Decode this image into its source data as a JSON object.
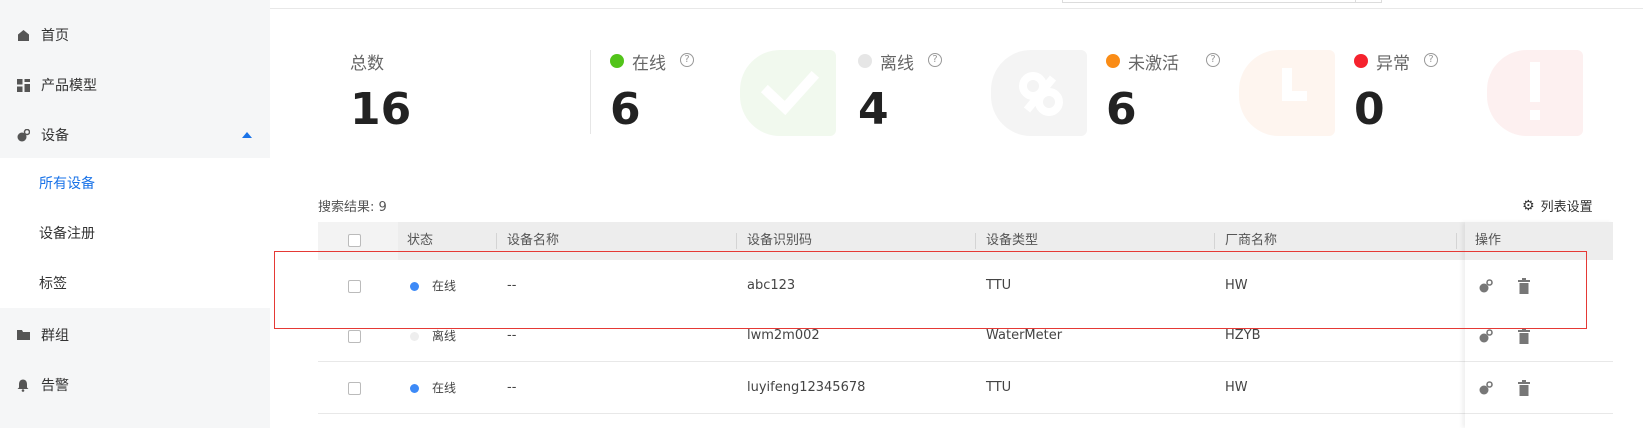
{
  "sidebar": {
    "items": [
      {
        "label": "首页",
        "icon": "home-icon"
      },
      {
        "label": "产品模型",
        "icon": "grid-icon"
      },
      {
        "label": "设备",
        "icon": "device-icon"
      },
      {
        "label": "群组",
        "icon": "folder-icon"
      },
      {
        "label": "告警",
        "icon": "bell-icon"
      }
    ],
    "sub_items": [
      {
        "label": "所有设备",
        "active": true
      },
      {
        "label": "设备注册",
        "active": false
      },
      {
        "label": "标签",
        "active": false
      }
    ]
  },
  "stats": {
    "total_label": "总数",
    "total_value": "16",
    "items": [
      {
        "label": "在线",
        "value": "6",
        "color": "#52c41a",
        "help": "?"
      },
      {
        "label": "离线",
        "value": "4",
        "color": "#e6e6e6",
        "help": "?"
      },
      {
        "label": "未激活",
        "value": "6",
        "color": "#fa8c16",
        "help": "?"
      },
      {
        "label": "异常",
        "value": "0",
        "color": "#f5222d",
        "help": "?"
      }
    ]
  },
  "table": {
    "result_label": "搜索结果: 9",
    "settings_label": "列表设置",
    "headers": [
      "状态",
      "设备名称",
      "设备识别码",
      "设备类型",
      "厂商名称",
      "操作"
    ],
    "rows": [
      {
        "status": "在线",
        "status_color": "#3d8af7",
        "name": "--",
        "code": "abc123",
        "type": "TTU",
        "vendor": "HW"
      },
      {
        "status": "离线",
        "status_color": "#eeeeee",
        "name": "--",
        "code": "lwm2m002",
        "type": "WaterMeter",
        "vendor": "HZYB"
      },
      {
        "status": "在线",
        "status_color": "#3d8af7",
        "name": "--",
        "code": "luyifeng12345678",
        "type": "TTU",
        "vendor": "HW"
      }
    ]
  },
  "colors": {
    "accent": "#1a73e8",
    "highlight": "#e53935"
  }
}
